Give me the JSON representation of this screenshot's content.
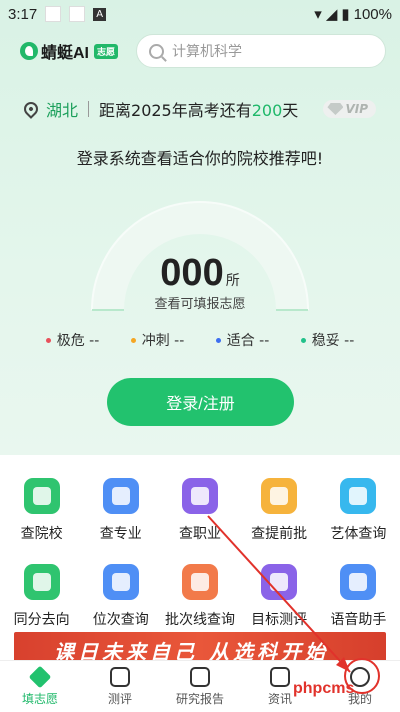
{
  "status_bar": {
    "time": "3:17",
    "battery": "100%"
  },
  "header": {
    "logo_text": "蜻蜓AI",
    "logo_tag": "志愿",
    "search_placeholder": "计算机科学"
  },
  "location": {
    "province": "湖北",
    "countdown_prefix": "距离2025年高考还有",
    "days": "200",
    "days_suffix": "天",
    "vip": "VIP"
  },
  "prompt": "登录系统查看适合你的院校推荐吧!",
  "gauge": {
    "count": "000",
    "unit": "所",
    "subtitle": "查看可填报志愿"
  },
  "legend": [
    {
      "label": "极危 --",
      "color": "#e8505b"
    },
    {
      "label": "冲刺 --",
      "color": "#f5a623"
    },
    {
      "label": "适合 --",
      "color": "#3d6ef0"
    },
    {
      "label": "稳妥 --",
      "color": "#21c18a"
    }
  ],
  "login_button": "登录/注册",
  "tools": [
    {
      "label": "查院校",
      "color": "#2fc46f",
      "icon": "school-icon"
    },
    {
      "label": "查专业",
      "color": "#4f8ff5",
      "icon": "major-check-icon"
    },
    {
      "label": "查职业",
      "color": "#8a63e8",
      "icon": "briefcase-icon"
    },
    {
      "label": "查提前批",
      "color": "#f6b33c",
      "icon": "calendar-icon"
    },
    {
      "label": "艺体查询",
      "color": "#37b8ee",
      "icon": "palette-icon"
    },
    {
      "label": "同分去向",
      "color": "#2fc46f",
      "icon": "same-score-icon"
    },
    {
      "label": "位次查询",
      "color": "#4f8ff5",
      "icon": "rank-icon"
    },
    {
      "label": "批次线查询",
      "color": "#f27a4a",
      "icon": "trend-icon"
    },
    {
      "label": "目标测评",
      "color": "#8a63e8",
      "icon": "target-doc-icon"
    },
    {
      "label": "语音助手",
      "color": "#4f8ff5",
      "icon": "microphone-icon"
    }
  ],
  "banner_text": "课日未来自己  从选科开始",
  "tabs": [
    {
      "label": "填志愿",
      "icon": "fill-form-icon",
      "active": true
    },
    {
      "label": "测评",
      "icon": "assessment-icon",
      "active": false
    },
    {
      "label": "研究报告",
      "icon": "report-icon",
      "active": false
    },
    {
      "label": "资讯",
      "icon": "news-icon",
      "active": false
    },
    {
      "label": "我的",
      "icon": "profile-icon",
      "active": false
    }
  ],
  "watermark": "phpcms",
  "annotation_color": "#e1322b"
}
